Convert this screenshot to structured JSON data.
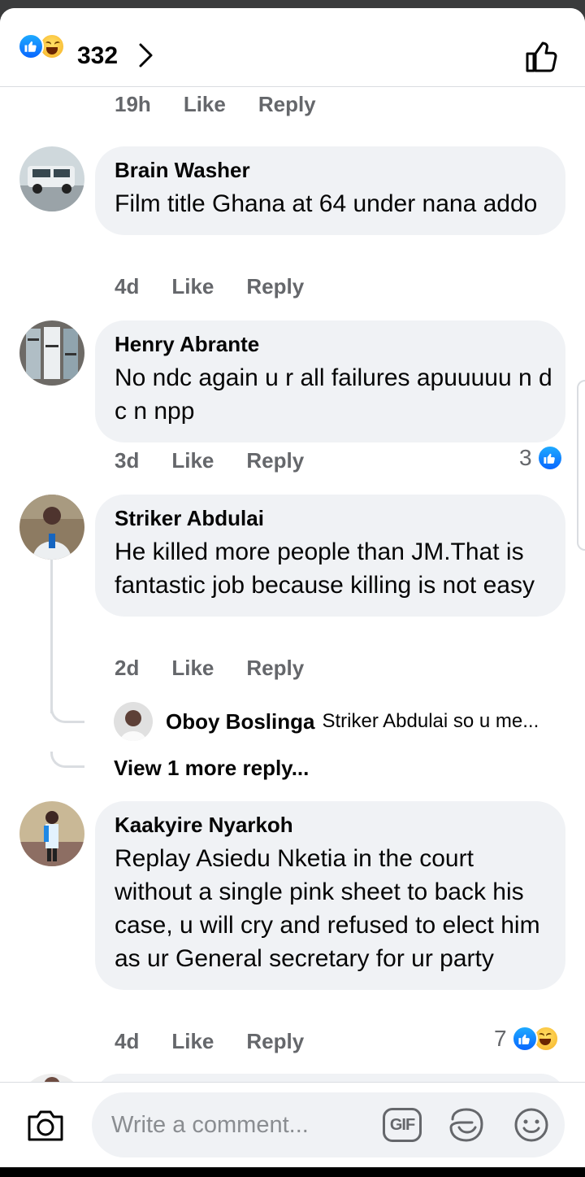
{
  "header": {
    "reaction_count": "332",
    "reaction_icons": [
      "like-icon",
      "haha-icon"
    ]
  },
  "comments": [
    {
      "meta": {
        "time": "19h",
        "like": "Like",
        "reply": "Reply"
      }
    },
    {
      "author": "Brain Washer",
      "text": "Film title Ghana at 64 under nana addo",
      "meta": {
        "time": "4d",
        "like": "Like",
        "reply": "Reply"
      }
    },
    {
      "author": "Henry Abrante",
      "text": "No ndc again u r all failures  apuuuuu n d c n npp",
      "meta": {
        "time": "3d",
        "like": "Like",
        "reply": "Reply"
      },
      "reactions": {
        "count": "3",
        "icons": [
          "like-icon"
        ]
      }
    },
    {
      "author": "Striker Abdulai",
      "text": "He killed more people than JM.That is fantastic job because killing is not easy",
      "meta": {
        "time": "2d",
        "like": "Like",
        "reply": "Reply"
      },
      "reply_preview": {
        "author": "Oboy Boslinga",
        "text": "Striker Abdulai so u me..."
      },
      "view_more": "View 1 more reply..."
    },
    {
      "author": "Kaakyire Nyarkoh",
      "text": "Replay Asiedu Nketia in the court without a single pink sheet to back his case, u will cry and refused to elect him as ur General secretary for ur party",
      "meta": {
        "time": "4d",
        "like": "Like",
        "reply": "Reply"
      },
      "reactions": {
        "count": "7",
        "icons": [
          "like-icon",
          "haha-icon"
        ]
      }
    }
  ],
  "composer": {
    "placeholder": "Write a comment...",
    "gif_label": "GIF"
  },
  "colors": {
    "accent": "#0866ff",
    "bubble": "#f0f2f5",
    "muted": "#65676b"
  }
}
